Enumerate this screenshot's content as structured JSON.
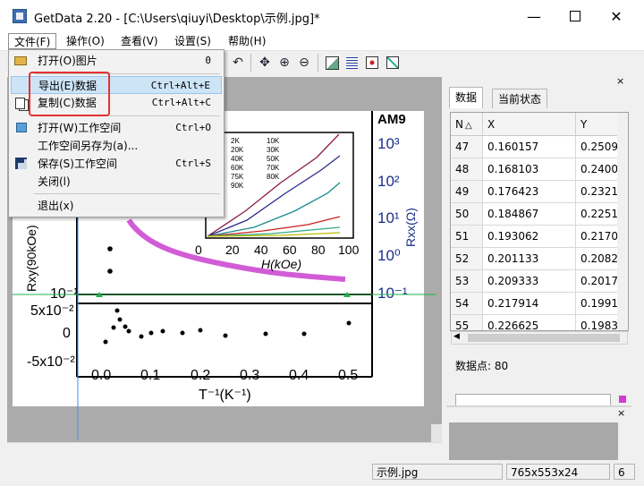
{
  "window": {
    "title": "GetData 2.20 - [C:\\Users\\qiuyi\\Desktop\\示例.jpg]*"
  },
  "menubar": [
    "文件(F)",
    "操作(O)",
    "查看(V)",
    "设置(S)",
    "帮助(H)"
  ],
  "file_menu": {
    "open_image": {
      "label": "打开(O)图片",
      "shortcut": "0"
    },
    "export_data": {
      "label": "导出(E)数据",
      "shortcut": "Ctrl+Alt+E"
    },
    "copy_data": {
      "label": "复制(C)数据",
      "shortcut": "Ctrl+Alt+C"
    },
    "open_workspace": {
      "label": "打开(W)工作空间",
      "shortcut": "Ctrl+O"
    },
    "save_workspace_as": {
      "label": "工作空间另存为(a)..."
    },
    "save_workspace": {
      "label": "保存(S)工作空间",
      "shortcut": "Ctrl+S"
    },
    "close": {
      "label": "关闭(l)"
    },
    "exit": {
      "label": "退出(x)"
    }
  },
  "panel": {
    "tabs": [
      "数据",
      "当前状态"
    ],
    "columns": [
      "N",
      "X",
      "Y"
    ],
    "rows": [
      [
        "47",
        "0.160157",
        "0.250979"
      ],
      [
        "48",
        "0.168103",
        "0.240047"
      ],
      [
        "49",
        "0.176423",
        "0.232131"
      ],
      [
        "50",
        "0.184867",
        "0.225182"
      ],
      [
        "51",
        "0.193062",
        "0.217073"
      ],
      [
        "52",
        "0.201133",
        "0.208271"
      ],
      [
        "53",
        "0.209333",
        "0.201721"
      ],
      [
        "54",
        "0.217914",
        "0.1991"
      ],
      [
        "55",
        "0.226625",
        "0.198376"
      ]
    ],
    "points_label": "数据点: 80",
    "close_glyph": "×"
  },
  "statusbar": {
    "filename": "示例.jpg",
    "size": "765x553x24",
    "extra": "6"
  },
  "image_text": {
    "am9": "AM9",
    "legend": [
      "2K",
      "20K",
      "40K",
      "60K",
      "75K",
      "90K",
      "10K",
      "30K",
      "50K",
      "70K",
      "80K"
    ],
    "inset_xticks": [
      "0",
      "20",
      "40",
      "60",
      "80",
      "100"
    ],
    "inset_xlabel": "H(kOe)",
    "right_ticks": [
      "10³",
      "10²",
      "10¹",
      "10⁰",
      "10⁻¹"
    ],
    "right_label": "Rxx(Ω)",
    "left_label": "Rxy(90kOe)",
    "left_tick": "10⁻¹",
    "lower_yticks": [
      "5x10⁻²",
      "0",
      "-5x10⁻²"
    ],
    "xticks": [
      "0.0",
      "0.1",
      "0.2",
      "0.3",
      "0.4",
      "0.5"
    ],
    "xlabel": "T⁻¹(K⁻¹)"
  },
  "colors": {
    "highlight_box": "#e53131",
    "menu_highlight": "#cde4f7",
    "magenta_curve": "#d25cd6",
    "green_line": "#22b14c"
  }
}
